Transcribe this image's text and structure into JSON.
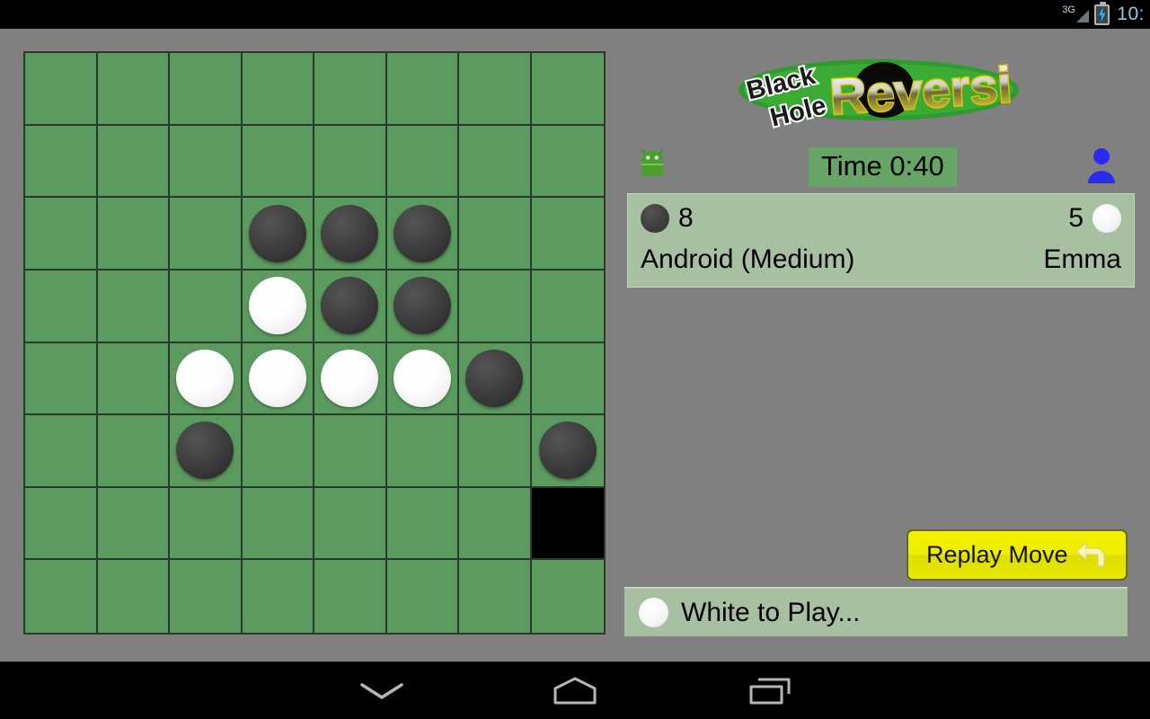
{
  "system": {
    "status_bar": {
      "network_label": "3G",
      "clock": "10:",
      "battery_icon": "battery-charging-icon",
      "signal_icon": "signal-bars-icon"
    },
    "nav_bar": {
      "back_label": "back-icon",
      "home_label": "home-icon",
      "recents_label": "recents-icon"
    }
  },
  "app": {
    "logo": {
      "line1": "Black",
      "line2": "Hole",
      "line3": "Reversi"
    },
    "timer": {
      "label": "Time 0:40"
    },
    "players": {
      "left": {
        "icon": "android-robot-icon",
        "score": "8",
        "name": "Android (Medium)",
        "disc": "black"
      },
      "right": {
        "icon": "person-icon",
        "score": "5",
        "name": "Emma",
        "disc": "white"
      }
    },
    "replay_button": {
      "label": "Replay Move",
      "icon": "undo-arrow-icon"
    },
    "status": {
      "text": "White to Play...",
      "disc": "white"
    },
    "colors": {
      "background": "#808080",
      "board_green": "#5b9b5f",
      "grid_line": "#2a3a2a",
      "panel_green": "#a7c0a1",
      "timer_green": "#66a566",
      "button_yellow": "#ededed00",
      "black_disc": "#3a3a3a",
      "white_disc": "#ffffff",
      "black_hole": "#000000"
    }
  },
  "chart_data": {
    "type": "table",
    "title": "Reversi board state 8x8",
    "grid_size": 8,
    "legend": [
      "empty",
      "black disc",
      "white disc",
      "black hole"
    ],
    "rows": [
      [
        "empty",
        "empty",
        "empty",
        "empty",
        "empty",
        "empty",
        "empty",
        "empty"
      ],
      [
        "empty",
        "empty",
        "empty",
        "empty",
        "empty",
        "empty",
        "empty",
        "empty"
      ],
      [
        "empty",
        "empty",
        "empty",
        "black",
        "black",
        "black",
        "empty",
        "empty"
      ],
      [
        "empty",
        "empty",
        "empty",
        "white",
        "black",
        "black",
        "empty",
        "empty"
      ],
      [
        "empty",
        "empty",
        "white",
        "white",
        "white",
        "white",
        "black",
        "empty"
      ],
      [
        "empty",
        "empty",
        "black",
        "empty",
        "empty",
        "empty",
        "empty",
        "black"
      ],
      [
        "empty",
        "empty",
        "empty",
        "empty",
        "empty",
        "empty",
        "empty",
        "hole"
      ],
      [
        "empty",
        "empty",
        "empty",
        "empty",
        "empty",
        "empty",
        "empty",
        "empty"
      ]
    ],
    "counts": {
      "black": 8,
      "white": 5
    }
  }
}
